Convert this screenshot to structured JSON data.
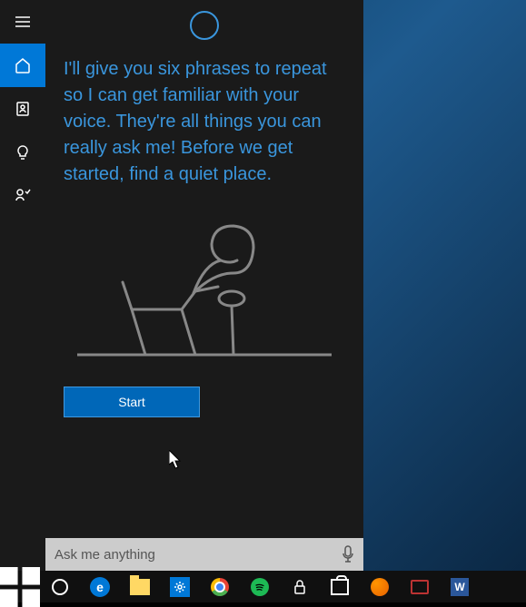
{
  "sidebar": {
    "items": [
      {
        "name": "hamburger"
      },
      {
        "name": "home",
        "selected": true
      },
      {
        "name": "notebook"
      },
      {
        "name": "tips"
      },
      {
        "name": "feedback"
      }
    ]
  },
  "content": {
    "instruction": "I'll give you six phrases to repeat so I can get familiar with your voice. They're all things you can really ask me! Before we get started, find a quiet place.",
    "start_label": "Start"
  },
  "search": {
    "placeholder": "Ask me anything"
  },
  "taskbar": {
    "items": [
      "start",
      "cortana",
      "edge",
      "file-explorer",
      "settings",
      "chrome",
      "spotify",
      "lock",
      "store",
      "firefox",
      "snipping-tool",
      "word"
    ]
  },
  "colors": {
    "accent": "#0078d7",
    "cortana_text": "#3a96dd"
  }
}
